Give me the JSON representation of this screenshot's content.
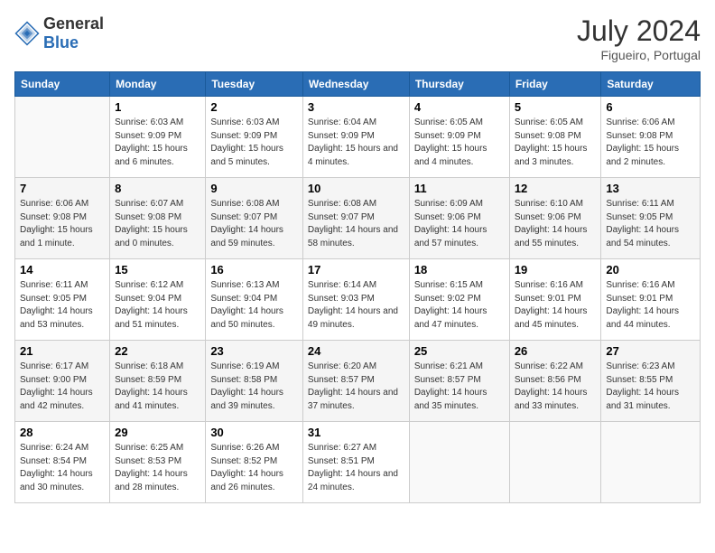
{
  "header": {
    "logo": {
      "general": "General",
      "blue": "Blue"
    },
    "title": "July 2024",
    "location": "Figueiro, Portugal"
  },
  "weekdays": [
    "Sunday",
    "Monday",
    "Tuesday",
    "Wednesday",
    "Thursday",
    "Friday",
    "Saturday"
  ],
  "weeks": [
    [
      {
        "day": "",
        "sunrise": "",
        "sunset": "",
        "daylight": ""
      },
      {
        "day": "1",
        "sunrise": "Sunrise: 6:03 AM",
        "sunset": "Sunset: 9:09 PM",
        "daylight": "Daylight: 15 hours and 6 minutes."
      },
      {
        "day": "2",
        "sunrise": "Sunrise: 6:03 AM",
        "sunset": "Sunset: 9:09 PM",
        "daylight": "Daylight: 15 hours and 5 minutes."
      },
      {
        "day": "3",
        "sunrise": "Sunrise: 6:04 AM",
        "sunset": "Sunset: 9:09 PM",
        "daylight": "Daylight: 15 hours and 4 minutes."
      },
      {
        "day": "4",
        "sunrise": "Sunrise: 6:05 AM",
        "sunset": "Sunset: 9:09 PM",
        "daylight": "Daylight: 15 hours and 4 minutes."
      },
      {
        "day": "5",
        "sunrise": "Sunrise: 6:05 AM",
        "sunset": "Sunset: 9:08 PM",
        "daylight": "Daylight: 15 hours and 3 minutes."
      },
      {
        "day": "6",
        "sunrise": "Sunrise: 6:06 AM",
        "sunset": "Sunset: 9:08 PM",
        "daylight": "Daylight: 15 hours and 2 minutes."
      }
    ],
    [
      {
        "day": "7",
        "sunrise": "Sunrise: 6:06 AM",
        "sunset": "Sunset: 9:08 PM",
        "daylight": "Daylight: 15 hours and 1 minute."
      },
      {
        "day": "8",
        "sunrise": "Sunrise: 6:07 AM",
        "sunset": "Sunset: 9:08 PM",
        "daylight": "Daylight: 15 hours and 0 minutes."
      },
      {
        "day": "9",
        "sunrise": "Sunrise: 6:08 AM",
        "sunset": "Sunset: 9:07 PM",
        "daylight": "Daylight: 14 hours and 59 minutes."
      },
      {
        "day": "10",
        "sunrise": "Sunrise: 6:08 AM",
        "sunset": "Sunset: 9:07 PM",
        "daylight": "Daylight: 14 hours and 58 minutes."
      },
      {
        "day": "11",
        "sunrise": "Sunrise: 6:09 AM",
        "sunset": "Sunset: 9:06 PM",
        "daylight": "Daylight: 14 hours and 57 minutes."
      },
      {
        "day": "12",
        "sunrise": "Sunrise: 6:10 AM",
        "sunset": "Sunset: 9:06 PM",
        "daylight": "Daylight: 14 hours and 55 minutes."
      },
      {
        "day": "13",
        "sunrise": "Sunrise: 6:11 AM",
        "sunset": "Sunset: 9:05 PM",
        "daylight": "Daylight: 14 hours and 54 minutes."
      }
    ],
    [
      {
        "day": "14",
        "sunrise": "Sunrise: 6:11 AM",
        "sunset": "Sunset: 9:05 PM",
        "daylight": "Daylight: 14 hours and 53 minutes."
      },
      {
        "day": "15",
        "sunrise": "Sunrise: 6:12 AM",
        "sunset": "Sunset: 9:04 PM",
        "daylight": "Daylight: 14 hours and 51 minutes."
      },
      {
        "day": "16",
        "sunrise": "Sunrise: 6:13 AM",
        "sunset": "Sunset: 9:04 PM",
        "daylight": "Daylight: 14 hours and 50 minutes."
      },
      {
        "day": "17",
        "sunrise": "Sunrise: 6:14 AM",
        "sunset": "Sunset: 9:03 PM",
        "daylight": "Daylight: 14 hours and 49 minutes."
      },
      {
        "day": "18",
        "sunrise": "Sunrise: 6:15 AM",
        "sunset": "Sunset: 9:02 PM",
        "daylight": "Daylight: 14 hours and 47 minutes."
      },
      {
        "day": "19",
        "sunrise": "Sunrise: 6:16 AM",
        "sunset": "Sunset: 9:01 PM",
        "daylight": "Daylight: 14 hours and 45 minutes."
      },
      {
        "day": "20",
        "sunrise": "Sunrise: 6:16 AM",
        "sunset": "Sunset: 9:01 PM",
        "daylight": "Daylight: 14 hours and 44 minutes."
      }
    ],
    [
      {
        "day": "21",
        "sunrise": "Sunrise: 6:17 AM",
        "sunset": "Sunset: 9:00 PM",
        "daylight": "Daylight: 14 hours and 42 minutes."
      },
      {
        "day": "22",
        "sunrise": "Sunrise: 6:18 AM",
        "sunset": "Sunset: 8:59 PM",
        "daylight": "Daylight: 14 hours and 41 minutes."
      },
      {
        "day": "23",
        "sunrise": "Sunrise: 6:19 AM",
        "sunset": "Sunset: 8:58 PM",
        "daylight": "Daylight: 14 hours and 39 minutes."
      },
      {
        "day": "24",
        "sunrise": "Sunrise: 6:20 AM",
        "sunset": "Sunset: 8:57 PM",
        "daylight": "Daylight: 14 hours and 37 minutes."
      },
      {
        "day": "25",
        "sunrise": "Sunrise: 6:21 AM",
        "sunset": "Sunset: 8:57 PM",
        "daylight": "Daylight: 14 hours and 35 minutes."
      },
      {
        "day": "26",
        "sunrise": "Sunrise: 6:22 AM",
        "sunset": "Sunset: 8:56 PM",
        "daylight": "Daylight: 14 hours and 33 minutes."
      },
      {
        "day": "27",
        "sunrise": "Sunrise: 6:23 AM",
        "sunset": "Sunset: 8:55 PM",
        "daylight": "Daylight: 14 hours and 31 minutes."
      }
    ],
    [
      {
        "day": "28",
        "sunrise": "Sunrise: 6:24 AM",
        "sunset": "Sunset: 8:54 PM",
        "daylight": "Daylight: 14 hours and 30 minutes."
      },
      {
        "day": "29",
        "sunrise": "Sunrise: 6:25 AM",
        "sunset": "Sunset: 8:53 PM",
        "daylight": "Daylight: 14 hours and 28 minutes."
      },
      {
        "day": "30",
        "sunrise": "Sunrise: 6:26 AM",
        "sunset": "Sunset: 8:52 PM",
        "daylight": "Daylight: 14 hours and 26 minutes."
      },
      {
        "day": "31",
        "sunrise": "Sunrise: 6:27 AM",
        "sunset": "Sunset: 8:51 PM",
        "daylight": "Daylight: 14 hours and 24 minutes."
      },
      {
        "day": "",
        "sunrise": "",
        "sunset": "",
        "daylight": ""
      },
      {
        "day": "",
        "sunrise": "",
        "sunset": "",
        "daylight": ""
      },
      {
        "day": "",
        "sunrise": "",
        "sunset": "",
        "daylight": ""
      }
    ]
  ]
}
